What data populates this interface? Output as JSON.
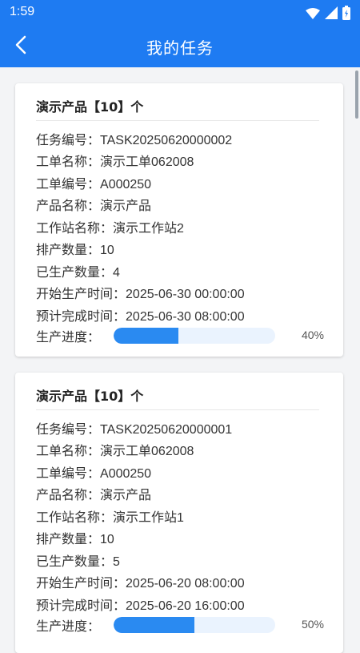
{
  "status_bar": {
    "time": "1:59",
    "icons": [
      "wifi-icon",
      "signal-icon",
      "battery-icon"
    ]
  },
  "app_bar": {
    "title": "我的任务",
    "back_icon": "chevron-left-icon"
  },
  "colors": {
    "primary": "#1e7bf2",
    "progress_fill": "#2a8af1",
    "progress_track": "#eaf3fe"
  },
  "tasks": [
    {
      "title": "演示产品【10】个",
      "fields": [
        {
          "label": "任务编号：",
          "value": "TASK20250620000002"
        },
        {
          "label": "工单名称：",
          "value": "演示工单062008"
        },
        {
          "label": "工单编号：",
          "value": "A000250"
        },
        {
          "label": "产品名称：",
          "value": "演示产品"
        },
        {
          "label": "工作站名称：",
          "value": "演示工作站2"
        },
        {
          "label": "排产数量：",
          "value": "10"
        },
        {
          "label": "已生产数量：",
          "value": "4"
        },
        {
          "label": "开始生产时间：",
          "value": "2025-06-30 00:00:00"
        },
        {
          "label": "预计完成时间：",
          "value": "2025-06-30 08:00:00"
        }
      ],
      "progress_label": "生产进度：",
      "progress_text": "40%",
      "progress": 0.4
    },
    {
      "title": "演示产品【10】个",
      "fields": [
        {
          "label": "任务编号：",
          "value": "TASK20250620000001"
        },
        {
          "label": "工单名称：",
          "value": "演示工单062008"
        },
        {
          "label": "工单编号：",
          "value": "A000250"
        },
        {
          "label": "产品名称：",
          "value": "演示产品"
        },
        {
          "label": "工作站名称：",
          "value": "演示工作站1"
        },
        {
          "label": "排产数量：",
          "value": "10"
        },
        {
          "label": "已生产数量：",
          "value": "5"
        },
        {
          "label": "开始生产时间：",
          "value": "2025-06-20 08:00:00"
        },
        {
          "label": "预计完成时间：",
          "value": "2025-06-20 16:00:00"
        }
      ],
      "progress_label": "生产进度：",
      "progress_text": "50%",
      "progress": 0.5
    }
  ]
}
